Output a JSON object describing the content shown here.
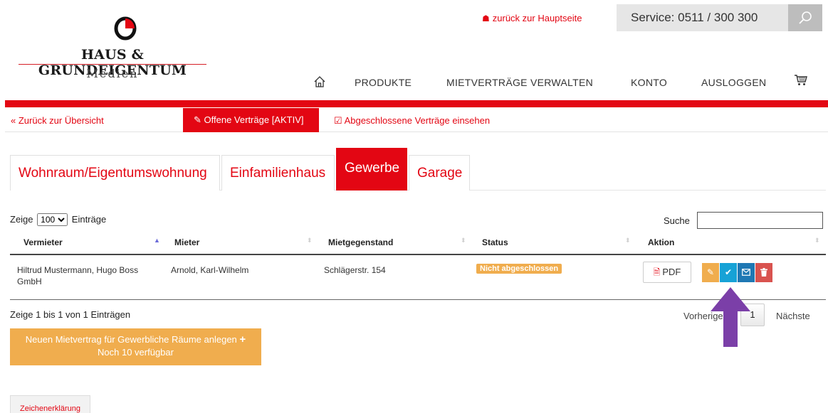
{
  "brand": {
    "name": "HAUS & GRUNDEIGENTUM",
    "subtitle": "Medien"
  },
  "header": {
    "home_link": "zurück zur Hauptseite",
    "service": "Service: 0511 / 300 300"
  },
  "nav": {
    "items": [
      "PRODUKTE",
      "MIETVERTRÄGE VERWALTEN",
      "KONTO",
      "AUSLOGGEN"
    ]
  },
  "subnav": {
    "back": "« Zurück zur Übersicht",
    "active": "Offene Verträge [AKTIV]",
    "closed": "Abgeschlossene Verträge einsehen"
  },
  "tabs": [
    "Wohnraum/Eigentumswohnung",
    "Einfamilienhaus",
    "Gewerbe",
    "Garage"
  ],
  "active_tab": "Gewerbe",
  "table": {
    "show_prefix": "Zeige",
    "show_value": "100",
    "show_suffix": "Einträge",
    "search_label": "Suche",
    "columns": [
      "Vermieter",
      "Mieter",
      "Mietgegenstand",
      "Status",
      "Aktion"
    ],
    "rows": [
      {
        "vermieter": "Hiltrud Mustermann, Hugo Boss GmbH",
        "mieter": "Arnold, Karl-Wilhelm",
        "mietgegenstand": "Schlägerstr. 154",
        "status": "Nicht abgeschlossen",
        "pdf": "PDF"
      }
    ],
    "info": "Zeige 1 bis 1 von 1 Einträgen",
    "pagination": {
      "prev": "Vorherige",
      "page": "1",
      "next": "Nächste"
    }
  },
  "new_contract": {
    "line1": "Neuen Mietvertrag für Gewerbliche Räume anlegen",
    "line2": "Noch 10 verfügbar"
  },
  "legend_button": "Zeichenerklärung",
  "colors": {
    "brand_red": "#e30613",
    "orange": "#f0ad4e",
    "cyan": "#17a2d6",
    "blue": "#1f78b4",
    "delete_red": "#d9534f",
    "annotation_arrow": "#7b3fa8"
  }
}
